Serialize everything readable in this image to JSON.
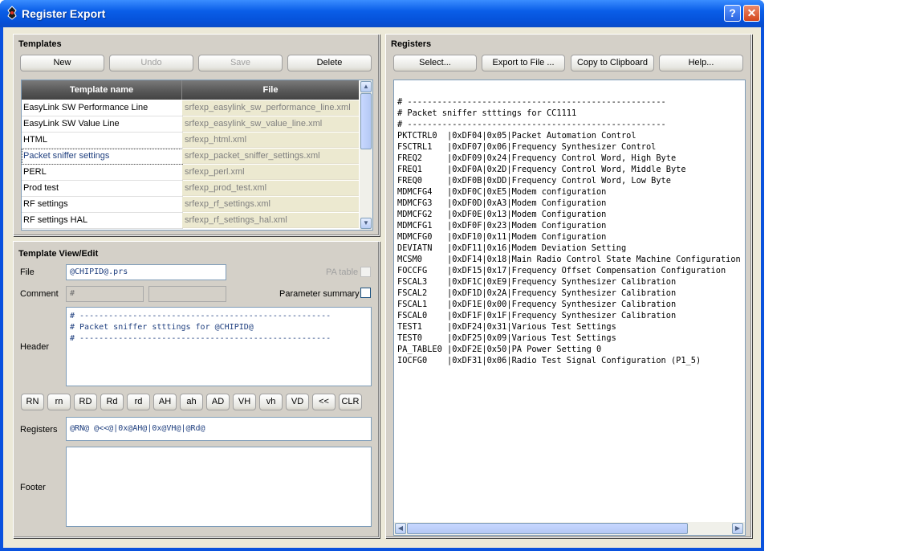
{
  "window": {
    "title": "Register Export",
    "help_glyph": "?",
    "close_glyph": "✕"
  },
  "templates": {
    "title": "Templates",
    "buttons": {
      "new": "New",
      "undo": "Undo",
      "save": "Save",
      "delete": "Delete"
    },
    "columns": [
      "Template name",
      "File"
    ],
    "rows": [
      {
        "name": "EasyLink SW Performance Line",
        "file": "srfexp_easylink_sw_performance_line.xml"
      },
      {
        "name": "EasyLink SW Value Line",
        "file": "srfexp_easylink_sw_value_line.xml"
      },
      {
        "name": "HTML",
        "file": "srfexp_html.xml"
      },
      {
        "name": "Packet sniffer settings",
        "file": "srfexp_packet_sniffer_settings.xml"
      },
      {
        "name": "PERL",
        "file": "srfexp_perl.xml"
      },
      {
        "name": "Prod test",
        "file": "srfexp_prod_test.xml"
      },
      {
        "name": "RF settings",
        "file": "srfexp_rf_settings.xml"
      },
      {
        "name": "RF settings HAL",
        "file": "srfexp_rf_settings_hal.xml"
      }
    ],
    "selected_row": 3
  },
  "template_edit": {
    "title": "Template View/Edit",
    "file_label": "File",
    "file_value": "@CHIPID@.prs",
    "pa_table_label": "PA table",
    "comment_label": "Comment",
    "comment_value": "#",
    "parameter_summary_label": "Parameter summary",
    "header_label": "Header",
    "header_lines": [
      "# ----------------------------------------------------",
      "# Packet sniffer stttings for @CHIPID@",
      "# ----------------------------------------------------"
    ],
    "symbol_buttons": [
      "RN",
      "rn",
      "RD",
      "Rd",
      "rd",
      "AH",
      "ah",
      "AD",
      "VH",
      "vh",
      "VD",
      "<<",
      "CLR"
    ],
    "registers_label": "Registers",
    "registers_value": "@RN@ @<<@|0x@AH@|0x@VH@|@Rd@",
    "footer_label": "Footer"
  },
  "registers": {
    "title": "Registers",
    "buttons": {
      "select": "Select...",
      "export": "Export to File ...",
      "clipboard": "Copy to Clipboard",
      "help": "Help..."
    },
    "lines": [
      "# ----------------------------------------------------",
      "# Packet sniffer stttings for CC1111",
      "# ----------------------------------------------------",
      "PKTCTRL0  |0xDF04|0x05|Packet Automation Control",
      "FSCTRL1   |0xDF07|0x06|Frequency Synthesizer Control",
      "FREQ2     |0xDF09|0x24|Frequency Control Word, High Byte",
      "FREQ1     |0xDF0A|0x2D|Frequency Control Word, Middle Byte",
      "FREQ0     |0xDF0B|0xDD|Frequency Control Word, Low Byte",
      "MDMCFG4   |0xDF0C|0xE5|Modem configuration",
      "MDMCFG3   |0xDF0D|0xA3|Modem Configuration",
      "MDMCFG2   |0xDF0E|0x13|Modem Configuration",
      "MDMCFG1   |0xDF0F|0x23|Modem Configuration",
      "MDMCFG0   |0xDF10|0x11|Modem Configuration",
      "DEVIATN   |0xDF11|0x16|Modem Deviation Setting",
      "MCSM0     |0xDF14|0x18|Main Radio Control State Machine Configuration",
      "FOCCFG    |0xDF15|0x17|Frequency Offset Compensation Configuration",
      "FSCAL3    |0xDF1C|0xE9|Frequency Synthesizer Calibration",
      "FSCAL2    |0xDF1D|0x2A|Frequency Synthesizer Calibration",
      "FSCAL1    |0xDF1E|0x00|Frequency Synthesizer Calibration",
      "FSCAL0    |0xDF1F|0x1F|Frequency Synthesizer Calibration",
      "TEST1     |0xDF24|0x31|Various Test Settings",
      "TEST0     |0xDF25|0x09|Various Test Settings",
      "PA_TABLE0 |0xDF2E|0x50|PA Power Setting 0",
      "IOCFG0    |0xDF31|0x06|Radio Test Signal Configuration (P1_5)"
    ]
  }
}
